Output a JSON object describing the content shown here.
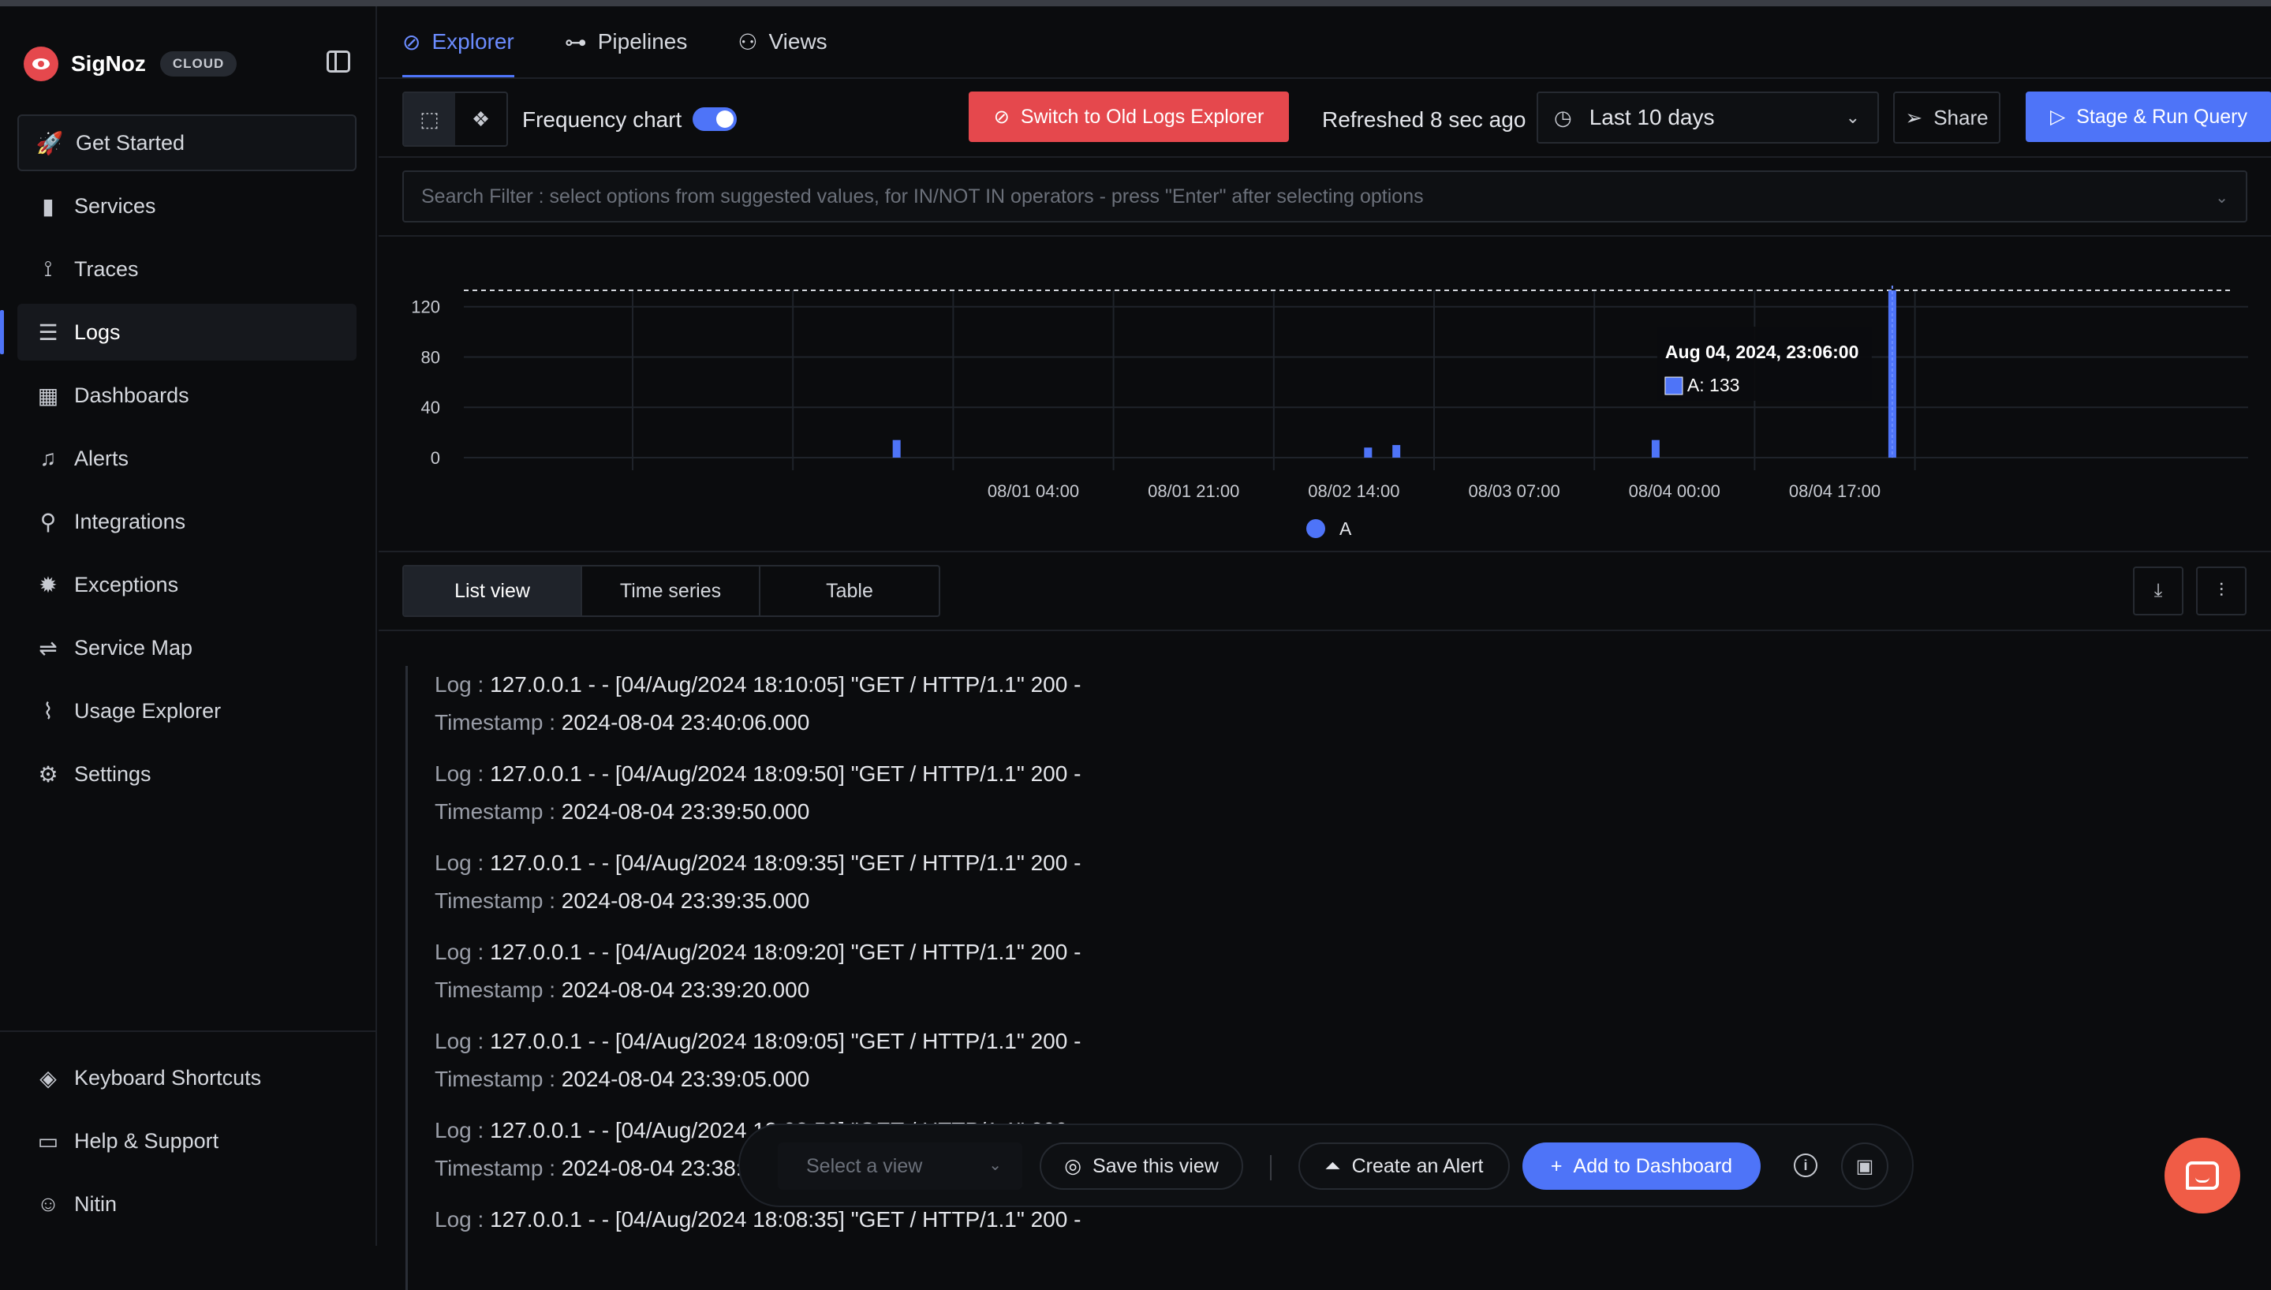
{
  "brand": {
    "name": "SigNoz",
    "badge": "CLOUD"
  },
  "sidebar": {
    "items": [
      {
        "label": "Get Started",
        "icon": "rocket-icon",
        "glyph": "🚀"
      },
      {
        "label": "Services",
        "icon": "bar-chart-icon",
        "glyph": "▮"
      },
      {
        "label": "Traces",
        "icon": "route-icon",
        "glyph": "⟟"
      },
      {
        "label": "Logs",
        "icon": "logs-icon",
        "glyph": "☰"
      },
      {
        "label": "Dashboards",
        "icon": "grid-icon",
        "glyph": "▦"
      },
      {
        "label": "Alerts",
        "icon": "bell-icon",
        "glyph": "♫"
      },
      {
        "label": "Integrations",
        "icon": "plug-icon",
        "glyph": "⚲"
      },
      {
        "label": "Exceptions",
        "icon": "bug-icon",
        "glyph": "✹"
      },
      {
        "label": "Service Map",
        "icon": "route-map-icon",
        "glyph": "⇌"
      },
      {
        "label": "Usage Explorer",
        "icon": "line-chart-icon",
        "glyph": "⌇"
      },
      {
        "label": "Settings",
        "icon": "gear-icon",
        "glyph": "⚙"
      }
    ],
    "bottom": [
      {
        "label": "Keyboard Shortcuts",
        "icon": "layers-icon",
        "glyph": "◈"
      },
      {
        "label": "Help & Support",
        "icon": "message-icon",
        "glyph": "▭"
      },
      {
        "label": "Nitin",
        "icon": "user-icon",
        "glyph": "☺"
      }
    ]
  },
  "tabs": [
    {
      "label": "Explorer",
      "glyph": "⊘"
    },
    {
      "label": "Pipelines",
      "glyph": "⊶"
    },
    {
      "label": "Views",
      "glyph": "⚇"
    }
  ],
  "toolbar": {
    "frequency_label": "Frequency chart",
    "old_explorer": "Switch to Old Logs Explorer",
    "refreshed": "Refreshed 8 sec ago",
    "time_range": "Last 10 days",
    "share": "Share",
    "run": "Stage & Run Query"
  },
  "search": {
    "placeholder": "Search Filter : select options from suggested values, for IN/NOT IN operators - press \"Enter\" after selecting options"
  },
  "chart_data": {
    "type": "bar",
    "series": [
      {
        "name": "A",
        "points": [
          {
            "x": "07/31 13:30",
            "y": 14
          },
          {
            "x": "08/02 15:30",
            "y": 8
          },
          {
            "x": "08/02 18:30",
            "y": 10
          },
          {
            "x": "08/03 22:00",
            "y": 14
          },
          {
            "x": "08/04 23:06",
            "y": 133
          }
        ]
      }
    ],
    "x_ticks": [
      "08/01 04:00",
      "08/01 21:00",
      "08/02 14:00",
      "08/03 07:00",
      "08/04 00:00",
      "08/04 17:00"
    ],
    "y_ticks": [
      0,
      40,
      80,
      120
    ],
    "ylim": [
      0,
      133
    ],
    "threshold_line": 133,
    "legend": "A",
    "legend_position": "bottom-center",
    "color": "#4e74f8",
    "tooltip": {
      "title": "Aug 04, 2024, 23:06:00",
      "value_label": "A: 133"
    }
  },
  "views": {
    "tabs": [
      "List view",
      "Time series",
      "Table"
    ],
    "active": "List view"
  },
  "logs": {
    "log_label": "Log :",
    "ts_label": "Timestamp :",
    "rows": [
      {
        "log": "127.0.0.1 - - [04/Aug/2024 18:10:05] \"GET / HTTP/1.1\" 200 -",
        "timestamp": "2024-08-04 23:40:06.000"
      },
      {
        "log": "127.0.0.1 - - [04/Aug/2024 18:09:50] \"GET / HTTP/1.1\" 200 -",
        "timestamp": "2024-08-04 23:39:50.000"
      },
      {
        "log": "127.0.0.1 - - [04/Aug/2024 18:09:35] \"GET / HTTP/1.1\" 200 -",
        "timestamp": "2024-08-04 23:39:35.000"
      },
      {
        "log": "127.0.0.1 - - [04/Aug/2024 18:09:20] \"GET / HTTP/1.1\" 200 -",
        "timestamp": "2024-08-04 23:39:20.000"
      },
      {
        "log": "127.0.0.1 - - [04/Aug/2024 18:09:05] \"GET / HTTP/1.1\" 200 -",
        "timestamp": "2024-08-04 23:39:05.000"
      },
      {
        "log": "127.0.0.1 - - [04/Aug/2024 18:08:50] \"GET / HTTP/1.1\" 200 -",
        "timestamp": "2024-08-04 23:38:50.000"
      },
      {
        "log": "127.0.0.1 - - [04/Aug/2024 18:08:35] \"GET / HTTP/1.1\" 200 -",
        "timestamp": ""
      }
    ]
  },
  "actionbar": {
    "view_placeholder": "Select a view",
    "save": "Save this view",
    "alert": "Create an Alert",
    "dashboard": "Add to Dashboard"
  },
  "colors": {
    "accent": "#4e74f8",
    "danger": "#e5484d",
    "chat": "#f05c46"
  }
}
